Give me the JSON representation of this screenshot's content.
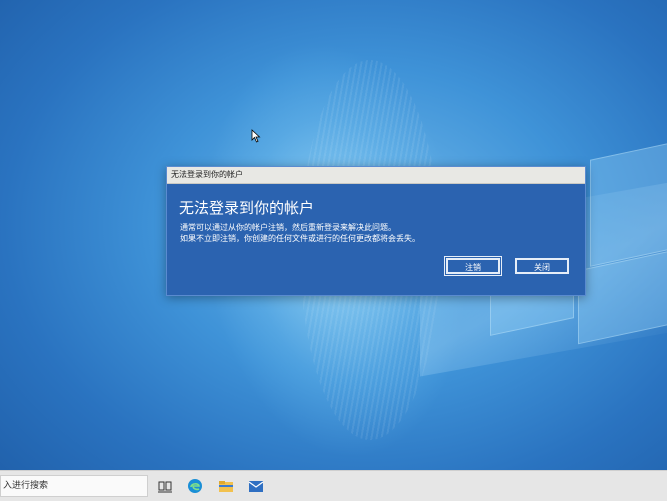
{
  "dialog": {
    "title_bar": "无法登录到你的帐户",
    "heading": "无法登录到你的帐户",
    "message_line1": "通常可以通过从你的帐户注销，然后重新登录来解决此问题。",
    "message_line2": "如果不立即注销，你创建的任何文件或进行的任何更改都将会丢失。",
    "buttons": {
      "sign_out": "注销",
      "close": "关闭"
    }
  },
  "taskbar": {
    "search_text": "入进行搜索",
    "icons": [
      "task-view-icon",
      "edge-browser-icon",
      "file-explorer-icon",
      "mail-icon"
    ]
  },
  "colors": {
    "dialog_bg": "#2b63b0",
    "desktop_blue": "#3f93d8",
    "taskbar_bg": "#e6e6e6"
  }
}
